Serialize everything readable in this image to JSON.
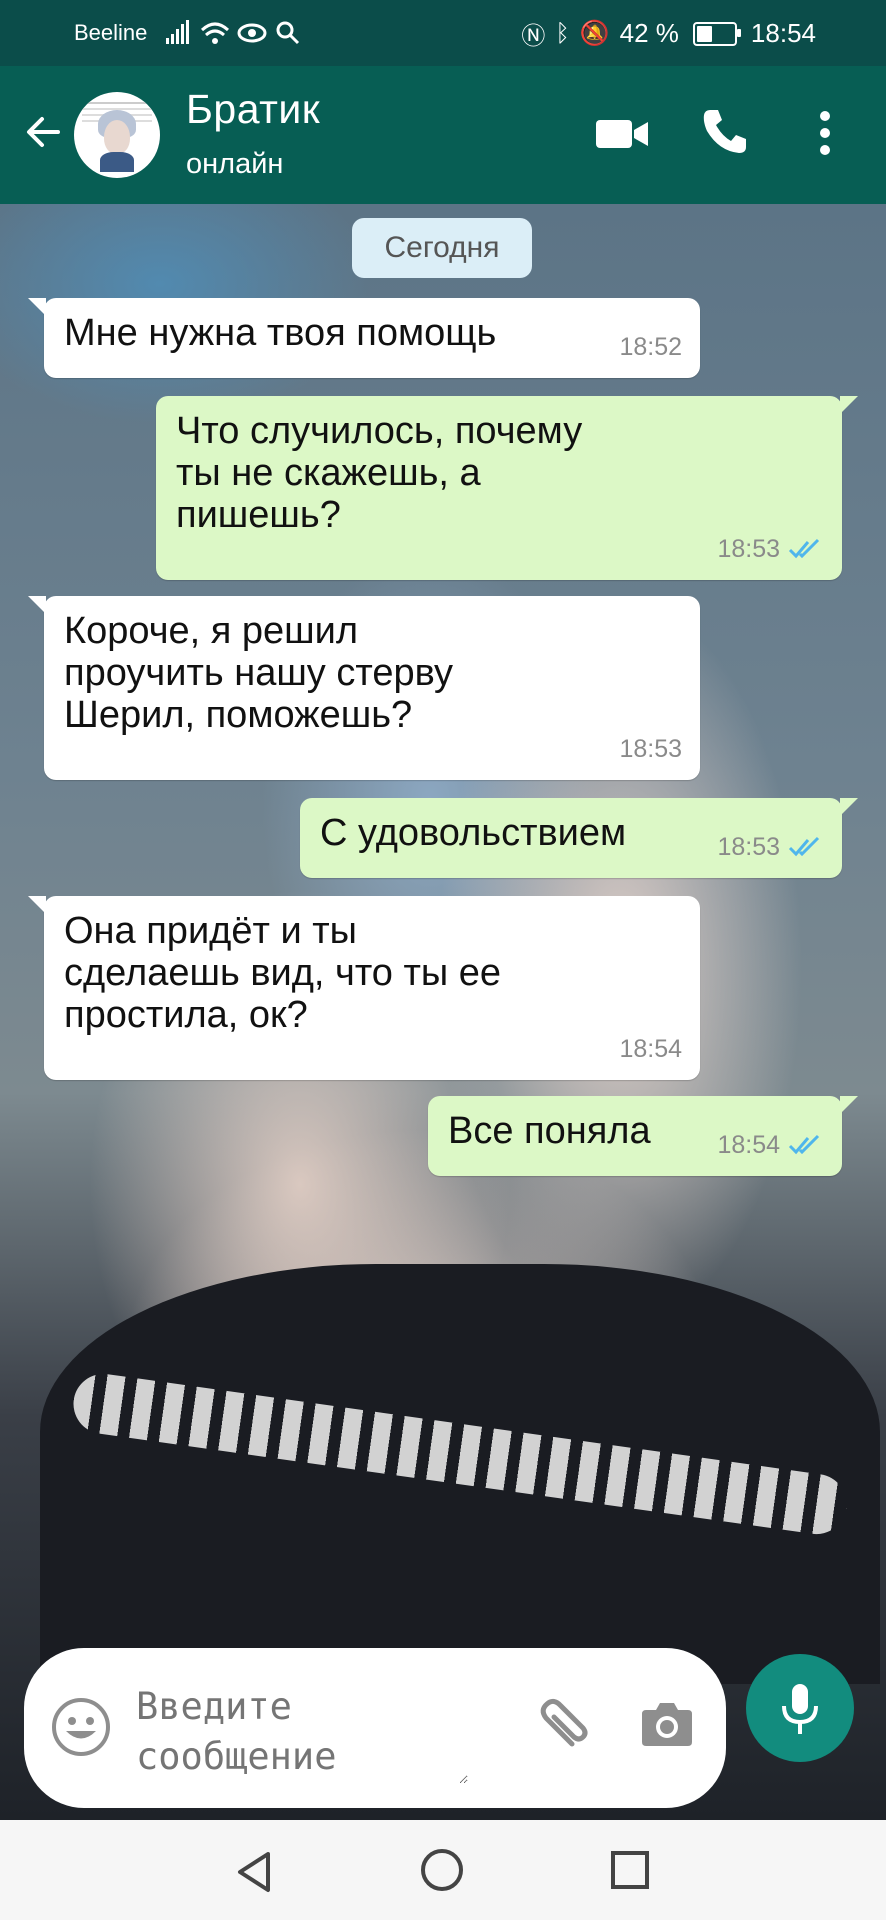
{
  "status_bar": {
    "carrier": "Beeline",
    "battery": "42 %",
    "battery_level": 0.42,
    "time": "18:54",
    "icons": [
      "signal-icon",
      "wifi-icon",
      "eye-icon",
      "search-icon",
      "nfc-icon",
      "bluetooth-icon",
      "mute-bell-icon",
      "battery-icon"
    ]
  },
  "header": {
    "contact_name": "Братик",
    "contact_status": "онлайн",
    "icons": [
      "back-arrow-icon",
      "video-call-icon",
      "phone-icon",
      "more-vert-icon"
    ]
  },
  "chat": {
    "date_chip": "Сегодня",
    "messages": [
      {
        "dir": "in",
        "text": "Мне нужна твоя помощь",
        "time": "18:52"
      },
      {
        "dir": "out",
        "text": "Что случилось, почему\nты не скажешь, а\nпишешь?",
        "time": "18:53",
        "read": true
      },
      {
        "dir": "in",
        "text": "Короче, я решил\nпроучить нашу стерву\nШерил, поможешь?",
        "time": "18:53"
      },
      {
        "dir": "out",
        "text": "С удовольствием",
        "time": "18:53",
        "read": true
      },
      {
        "dir": "in",
        "text": "Она придёт и ты\nсделаешь вид, что ты ее\nпростила, ок?",
        "time": "18:54"
      },
      {
        "dir": "out",
        "text": "Все поняла",
        "time": "18:54",
        "read": true
      }
    ]
  },
  "composer": {
    "placeholder": "Введите\nсообщение",
    "icons": [
      "emoji-icon",
      "attach-icon",
      "camera-icon",
      "mic-icon"
    ]
  },
  "colors": {
    "header": "#075e54",
    "status_bar": "#0b4d4a",
    "outgoing_bubble": "#dcf8c6",
    "incoming_bubble": "#ffffff",
    "read_ticks": "#4fb6ec",
    "mic_button": "#128c7e"
  }
}
